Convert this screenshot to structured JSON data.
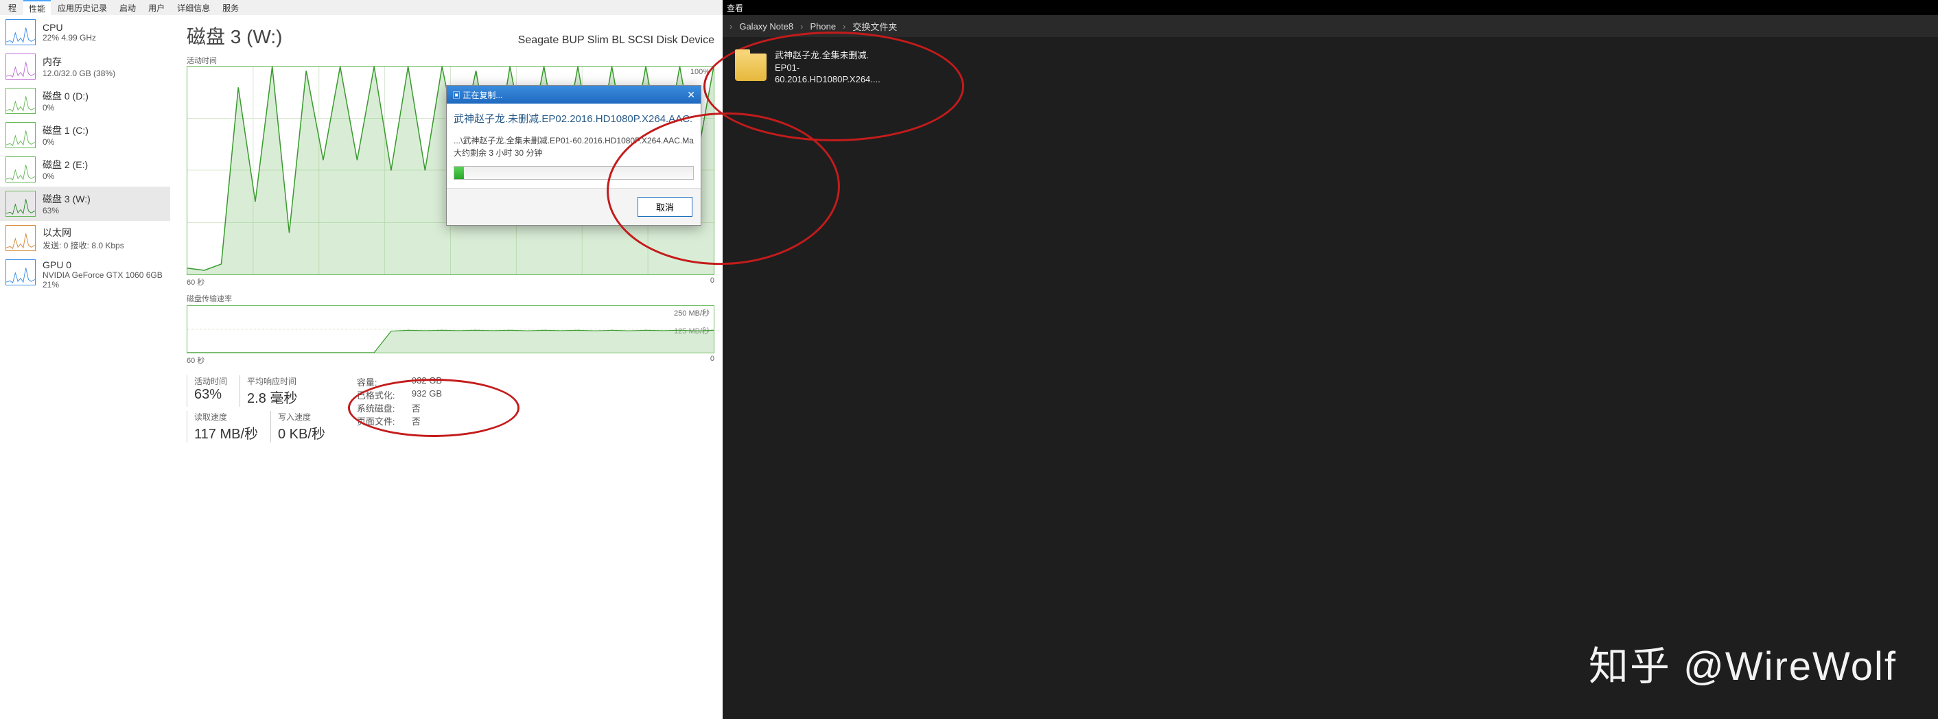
{
  "menu": [
    "程",
    "性能",
    "应用历史记录",
    "启动",
    "用户",
    "详细信息",
    "服务"
  ],
  "sidebar": [
    {
      "title": "CPU",
      "sub": "22%  4.99 GHz",
      "border": "#3a8ee6",
      "stroke": "#3a8ee6"
    },
    {
      "title": "内存",
      "sub": "12.0/32.0 GB (38%)",
      "border": "#c070d8",
      "stroke": "#c070d8"
    },
    {
      "title": "磁盘 0 (D:)",
      "sub": "0%",
      "border": "#69b95a",
      "stroke": "#69b95a"
    },
    {
      "title": "磁盘 1 (C:)",
      "sub": "0%",
      "border": "#69b95a",
      "stroke": "#69b95a"
    },
    {
      "title": "磁盘 2 (E:)",
      "sub": "0%",
      "border": "#69b95a",
      "stroke": "#69b95a"
    },
    {
      "title": "磁盘 3 (W:)",
      "sub": "63%",
      "border": "#69b95a",
      "stroke": "#2e8b2e",
      "selected": true
    },
    {
      "title": "以太网",
      "sub": "发送: 0  接收: 8.0 Kbps",
      "border": "#d48a39",
      "stroke": "#d48a39"
    },
    {
      "title": "GPU 0",
      "sub": "NVIDIA GeForce GTX 1060 6GB\n21%",
      "border": "#3a8ee6",
      "stroke": "#3a8ee6"
    }
  ],
  "main": {
    "title": "磁盘 3 (W:)",
    "device": "Seagate BUP Slim BL SCSI Disk Device",
    "graph1_label": "活动时间",
    "graph1_max": "100%",
    "graph1_min_x": "60 秒",
    "graph1_min_y": "0",
    "graph2_label": "磁盘传输速率",
    "graph2_max": "250 MB/秒",
    "graph2_mid": "125 MB/秒",
    "stats": [
      {
        "label": "活动时间",
        "value": "63%"
      },
      {
        "label": "平均响应时间",
        "value": "2.8 毫秒"
      }
    ],
    "stats2": [
      {
        "label": "读取速度",
        "value": "117 MB/秒"
      },
      {
        "label": "写入速度",
        "value": "0 KB/秒"
      }
    ],
    "kv": [
      {
        "k": "容量:",
        "v": "932 GB"
      },
      {
        "k": "已格式化:",
        "v": "932 GB"
      },
      {
        "k": "系统磁盘:",
        "v": "否"
      },
      {
        "k": "页面文件:",
        "v": "否"
      }
    ]
  },
  "dialog": {
    "title": "正在复制...",
    "file": "武神赵子龙.未删减.EP02.2016.HD1080P.X264.AAC.",
    "dest": "...\\武神赵子龙.全集未删减.EP01-60.2016.HD1080P.X264.AAC.Ma",
    "eta": "大约剩余 3 小时 30 分钟",
    "cancel": "取消"
  },
  "explorer": {
    "menu": "查看",
    "crumbs": [
      "Galaxy Note8",
      "Phone",
      "交换文件夹"
    ],
    "folder_line1": "武神赵子龙.全集未删减.",
    "folder_line2": "EP01-60.2016.HD1080P.X264...."
  },
  "watermark": "知乎 @WireWolf",
  "chart_data": {
    "type": "line",
    "title": "磁盘 3 (W:) 活动时间 / 传输速率",
    "series": [
      {
        "name": "活动时间 %",
        "ylim": [
          0,
          100
        ],
        "x_range_s": 60,
        "values": [
          3,
          2,
          5,
          90,
          35,
          100,
          20,
          98,
          55,
          100,
          55,
          100,
          50,
          100,
          50,
          100,
          60,
          98,
          50,
          100,
          58,
          100,
          55,
          100,
          52,
          100,
          55,
          100,
          55,
          100,
          55,
          100
        ]
      },
      {
        "name": "传输速率 MB/秒",
        "ylim": [
          0,
          250
        ],
        "x_range_s": 60,
        "values": [
          0,
          0,
          0,
          0,
          0,
          0,
          0,
          0,
          0,
          0,
          0,
          0,
          115,
          120,
          118,
          120,
          118,
          120,
          118,
          120,
          117,
          120,
          118,
          120,
          117,
          120,
          117,
          120,
          118,
          120,
          117,
          120
        ]
      }
    ]
  }
}
